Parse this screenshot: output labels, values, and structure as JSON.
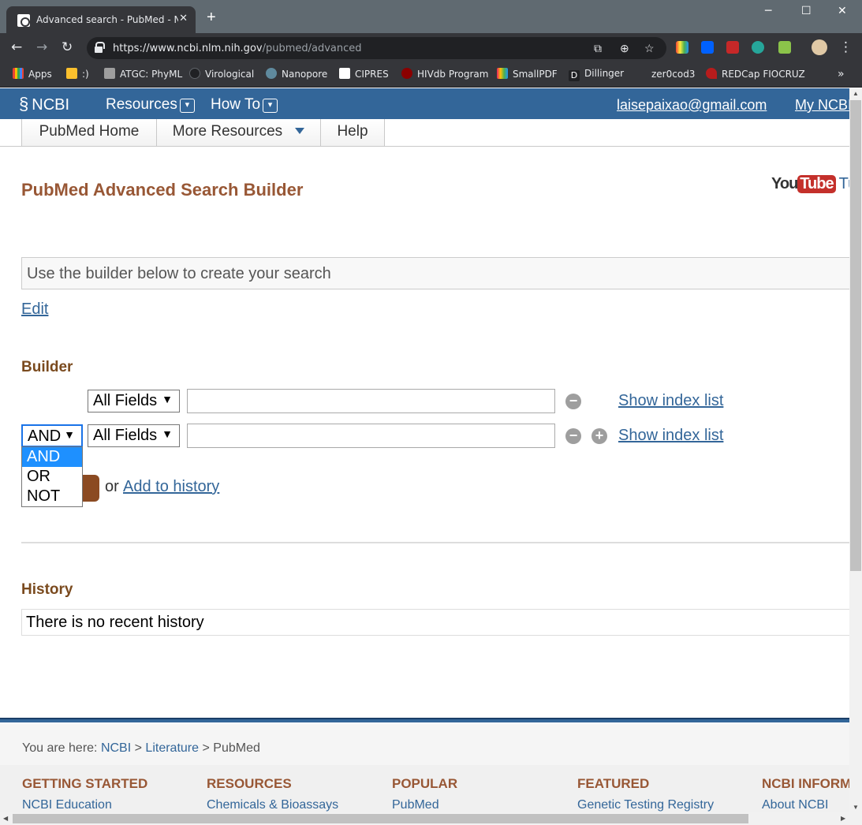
{
  "browser": {
    "tab_title": "Advanced search - PubMed - NC",
    "new_tab": "+",
    "url_host": "https://www.ncbi.nlm.nih.gov",
    "url_path": "/pubmed/advanced",
    "window_controls": [
      "─",
      "☐",
      "✕"
    ]
  },
  "bookmarks": [
    {
      "label": "Apps",
      "color": "#ea4335"
    },
    {
      "label": ":)",
      "color": "#fbc02d"
    },
    {
      "label": "ATGC: PhyML",
      "color": "#9e9e9e"
    },
    {
      "label": "Virological",
      "color": "#202124"
    },
    {
      "label": "Nanopore",
      "color": "#5f8a9e"
    },
    {
      "label": "CIPRES",
      "color": "#ffffff"
    },
    {
      "label": "HIVdb Program",
      "color": "#8b0000"
    },
    {
      "label": "SmallPDF",
      "color": "#e91e63"
    },
    {
      "label": "Dillinger",
      "color": "#202124"
    },
    {
      "label": "zer0cod3",
      "color": "#35363a"
    },
    {
      "label": "REDCap FIOCRUZ",
      "color": "#b71c1c"
    }
  ],
  "ncbi": {
    "logo": "NCBI",
    "resources": "Resources",
    "how_to": "How To",
    "email": "laisepaixao@gmail.com",
    "my_ncbi": "My NCBI"
  },
  "subnav": {
    "home": "PubMed Home",
    "more": "More Resources",
    "help": "Help"
  },
  "page": {
    "title": "PubMed Advanced Search Builder",
    "youtube_you": "You",
    "youtube_tube": "Tube",
    "youtube_tut": "Tu",
    "query_placeholder": "Use the builder below to create your search",
    "edit": "Edit",
    "builder_heading": "Builder",
    "field1": "All Fields",
    "field2": "All Fields",
    "operator": "AND",
    "show_index_1": "Show index list",
    "show_index_2": "Show index list",
    "operator_options": [
      "AND",
      "OR",
      "NOT"
    ],
    "or_text": "or",
    "add_to_history": "Add to history",
    "history_heading": "History",
    "history_empty": "There is no recent history"
  },
  "footer": {
    "you_are_here": "You are here:",
    "crumb_ncbi": "NCBI",
    "crumb_lit": "Literature",
    "crumb_pubmed": "PubMed",
    "sep": ">",
    "cols": [
      {
        "heading": "GETTING STARTED",
        "link": "NCBI Education"
      },
      {
        "heading": "RESOURCES",
        "link": "Chemicals & Bioassays"
      },
      {
        "heading": "POPULAR",
        "link": "PubMed"
      },
      {
        "heading": "FEATURED",
        "link": "Genetic Testing Registry"
      },
      {
        "heading": "NCBI INFORMATION",
        "link": "About NCBI"
      }
    ]
  }
}
